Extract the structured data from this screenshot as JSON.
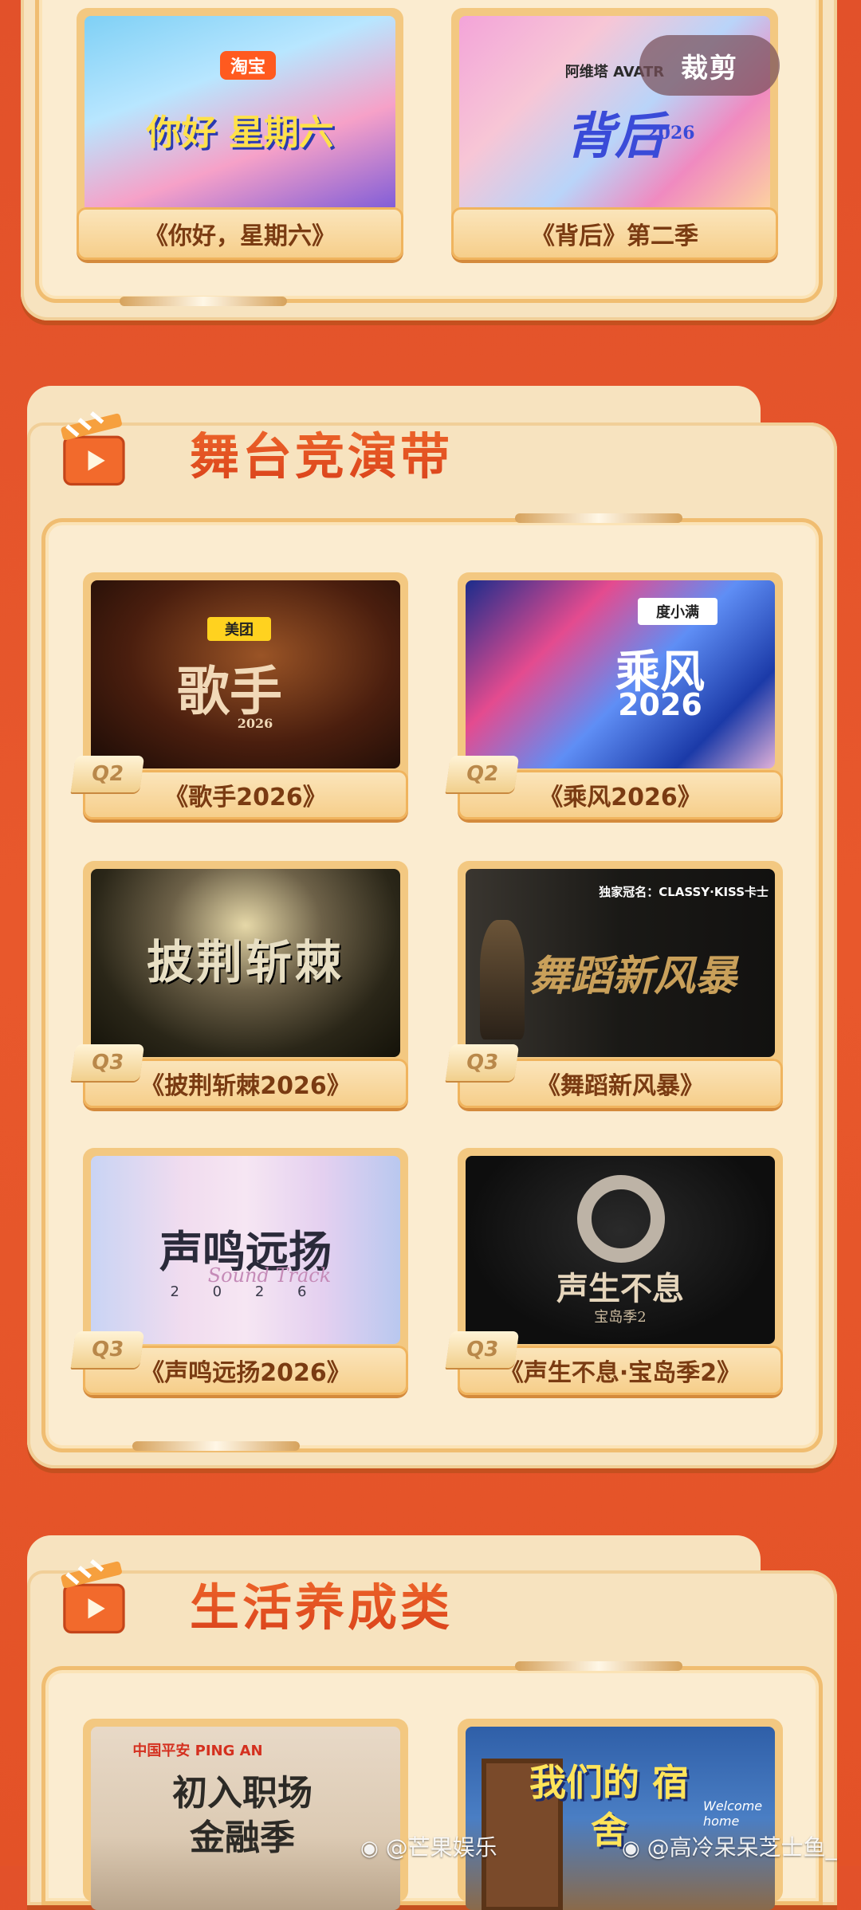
{
  "top_section": {
    "cards": [
      {
        "title": "《你好，星期六》",
        "poster_main": "你好 星期六",
        "poster_brand": "淘宝"
      },
      {
        "title": "《背后》第二季",
        "poster_main": "背后",
        "poster_sub": "2026",
        "poster_brand": "阿维塔 AVATR"
      }
    ]
  },
  "stage_section": {
    "title": "舞台竞演带",
    "cards": [
      {
        "title": "《歌手2026》",
        "quarter": "Q2",
        "poster_main": "歌手",
        "poster_sub": "2026",
        "poster_brand": "美团"
      },
      {
        "title": "《乘风2026》",
        "quarter": "Q2",
        "poster_main": "乘风",
        "poster_sub": "2026",
        "poster_brand": "度小满"
      },
      {
        "title": "《披荆斩棘2026》",
        "quarter": "Q3",
        "poster_main": "披荆斩棘"
      },
      {
        "title": "《舞蹈新风暴》",
        "quarter": "Q3",
        "poster_main": "舞蹈新风暴",
        "poster_brand": "独家冠名：CLASSY·KISS卡士"
      },
      {
        "title": "《声鸣远扬2026》",
        "quarter": "Q3",
        "poster_main": "声鸣远扬",
        "poster_sub": "2 0 2 6",
        "poster_script": "Sound Track"
      },
      {
        "title": "《声生不息·宝岛季2》",
        "quarter": "Q3",
        "poster_main": "声生不息",
        "poster_sub": "宝岛季2"
      }
    ]
  },
  "life_section": {
    "title": "生活养成类",
    "cards": [
      {
        "poster_main": "初入职场 金融季",
        "poster_brand": "中国平安 PING AN"
      },
      {
        "poster_main": "我们的 宿舍",
        "poster_sub": "Welcome home"
      }
    ]
  },
  "overlay": {
    "crop_button": "裁剪",
    "watermark_left": "@芒果娱乐",
    "watermark_right": "@高冷呆呆芝士鱼_"
  }
}
